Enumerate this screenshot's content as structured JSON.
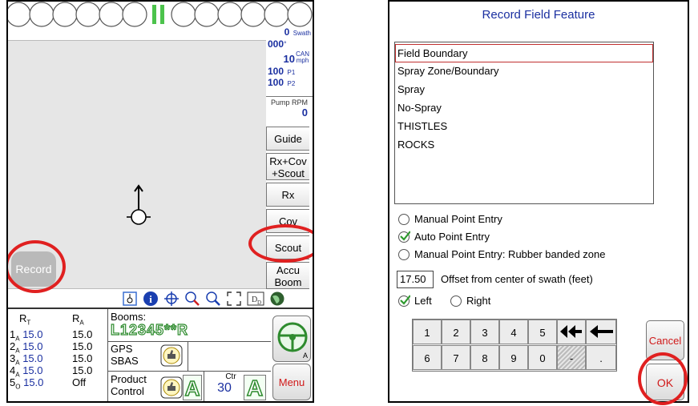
{
  "left": {
    "readouts": {
      "swath_val": "0",
      "swath_unit": "Swath",
      "heading_val": "000",
      "heading_unit": "°",
      "speed_val": "10",
      "speed_unit_top": "CAN",
      "speed_unit_bot": "mph",
      "p1_val": "100",
      "p1_unit": "P1",
      "p2_val": "100",
      "p2_unit": "P2",
      "pump_label": "Pump RPM",
      "pump_val": "0"
    },
    "side_buttons": {
      "guide": "Guide",
      "rxcov_line1": "Rx+Cov",
      "rxcov_line2": "+Scout",
      "rx": "Rx",
      "cov": "Cov",
      "scout": "Scout",
      "accu_line1": "Accu",
      "accu_line2": "Boom"
    },
    "record_button": "Record",
    "rates": {
      "rt_head": "R",
      "rt_sub": "T",
      "ra_head": "R",
      "ra_sub": "A",
      "rows": [
        {
          "num": "1",
          "sub": "A",
          "rt": "15.0",
          "ra": "15.0"
        },
        {
          "num": "2",
          "sub": "A",
          "rt": "15.0",
          "ra": "15.0"
        },
        {
          "num": "3",
          "sub": "A",
          "rt": "15.0",
          "ra": "15.0"
        },
        {
          "num": "4",
          "sub": "A",
          "rt": "15.0",
          "ra": "15.0"
        },
        {
          "num": "5",
          "sub": "O",
          "rt": "15.0",
          "ra": "Off"
        }
      ]
    },
    "booms_label": "Booms:",
    "booms_value": "L12345**R",
    "gps_line1": "GPS",
    "gps_line2": "SBAS",
    "product_line1": "Product",
    "product_line2": "Control",
    "mode_letter": "A",
    "ctr_label": "Ctr",
    "ctr_value": "30",
    "steer_sub": "A",
    "menu_label": "Menu",
    "toolbar_icons": [
      "coverage-toggle-icon",
      "info-icon",
      "crosshair-icon",
      "zoom-in-icon",
      "zoom-out-icon",
      "extents-icon",
      "day-night-icon",
      "globe-icon"
    ]
  },
  "right": {
    "title": "Record Field Feature",
    "features": [
      "Field Boundary",
      "Spray Zone/Boundary",
      "Spray",
      "No-Spray",
      "THISTLES",
      "ROCKS"
    ],
    "selected_feature": "Field Boundary",
    "entry_options": [
      {
        "label": "Manual Point Entry",
        "checked": false
      },
      {
        "label": "Auto Point Entry",
        "checked": true
      },
      {
        "label": "Manual Point Entry: Rubber banded zone",
        "checked": false
      }
    ],
    "offset_value": "17.50",
    "offset_label": "Offset from center of swath (feet)",
    "side_left": "Left",
    "side_right": "Right",
    "keys_row1": [
      "1",
      "2",
      "3",
      "4",
      "5"
    ],
    "keys_row2": [
      "6",
      "7",
      "8",
      "9",
      "0"
    ],
    "key_minus": "-",
    "key_dot": ".",
    "cancel_label": "Cancel",
    "ok_label": "OK"
  },
  "colors": {
    "highlight_ring": "#e02020",
    "readout_blue": "#1a2fa0",
    "boom_green": "#2e8b2e",
    "menu_red": "#d01818",
    "accent_green": "#3aa83a"
  }
}
